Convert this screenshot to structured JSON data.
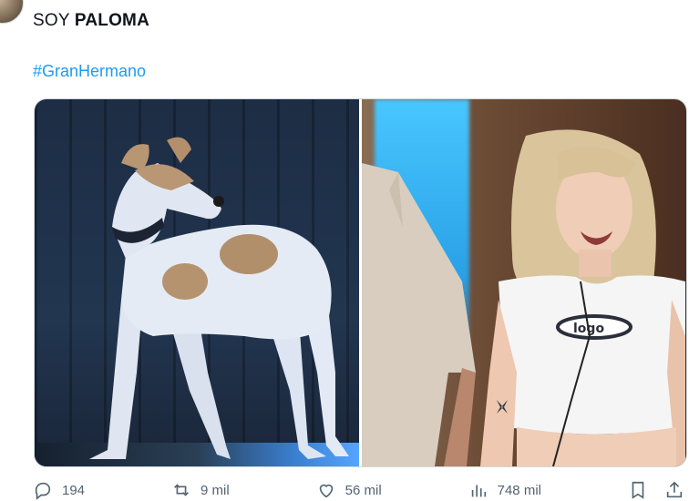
{
  "tweet": {
    "text_prefix": "SOY",
    "text_bold": "PALOMA",
    "hashtag": "#GranHermano"
  },
  "media": {
    "left_image_icon": "dog-photo-icon",
    "right_image_icon": "crying-person-photo-icon"
  },
  "actions": {
    "replies": "194",
    "retweets": "9 mil",
    "likes": "56 mil",
    "views": "748 mil"
  },
  "colors": {
    "accent": "#1d9bf0",
    "muted": "#536471"
  }
}
